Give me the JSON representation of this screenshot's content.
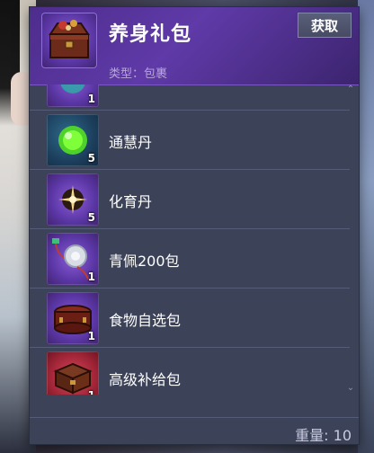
{
  "header": {
    "title": "养身礼包",
    "get_label": "获取",
    "type_label": "类型：包裹"
  },
  "items": [
    {
      "name": "",
      "qty": "1",
      "icon": "teal-orb-icon"
    },
    {
      "name": "通慧丹",
      "qty": "5",
      "icon": "green-pill-icon"
    },
    {
      "name": "化育丹",
      "qty": "5",
      "icon": "star-pill-icon"
    },
    {
      "name": "青佩200包",
      "qty": "1",
      "icon": "jade-pendant-icon"
    },
    {
      "name": "食物自选包",
      "qty": "1",
      "icon": "food-box-icon"
    },
    {
      "name": "高级补给包",
      "qty": "1",
      "icon": "supply-chest-icon"
    }
  ],
  "footer": {
    "weight_label": "重量: 10"
  }
}
